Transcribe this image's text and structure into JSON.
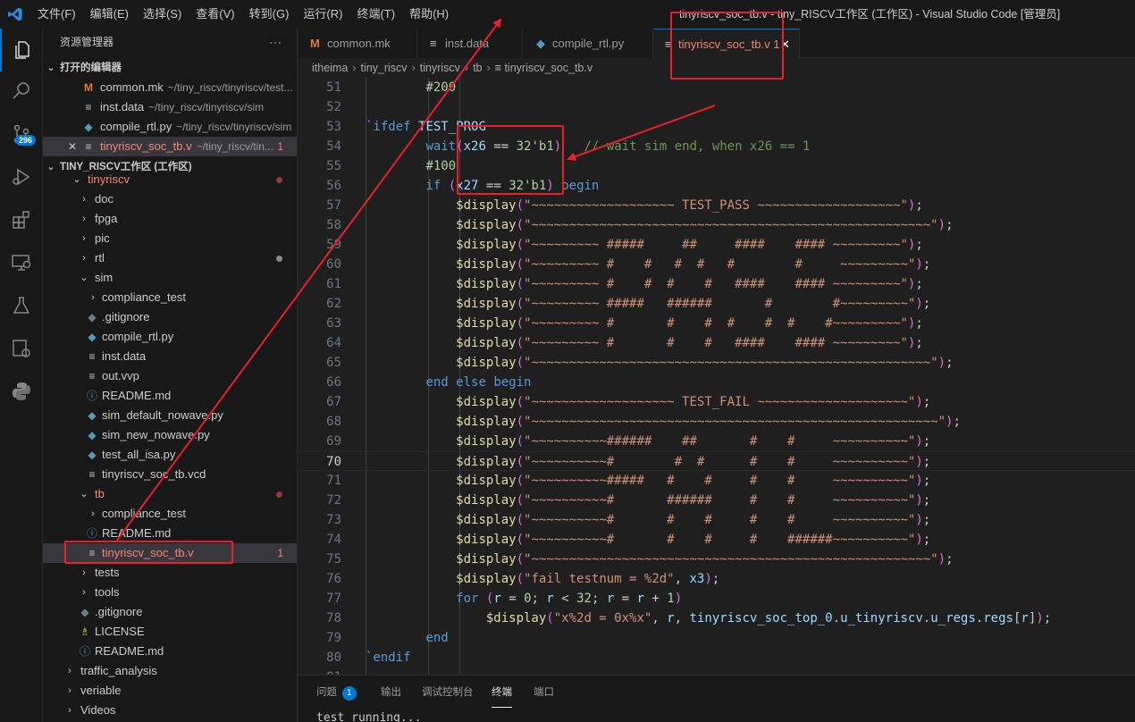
{
  "menu": [
    "文件(F)",
    "编辑(E)",
    "选择(S)",
    "查看(V)",
    "转到(G)",
    "运行(R)",
    "终端(T)",
    "帮助(H)"
  ],
  "window_title": "tinyriscv_soc_tb.v - tiny_RISCV工作区 (工作区) - Visual Studio Code [管理员]",
  "activity": {
    "scm_badge": "296"
  },
  "sidebar": {
    "title": "资源管理器",
    "more": "···",
    "open_editors_header": "打开的编辑器",
    "open_editors": [
      {
        "name": "common.mk",
        "desc": "~/tiny_riscv/tinyriscv/test..."
      },
      {
        "name": "inst.data",
        "desc": "~/tiny_riscv/tinyriscv/sim"
      },
      {
        "name": "compile_rtl.py",
        "desc": "~/tiny_riscv/tinyriscv/sim"
      },
      {
        "name": "tinyriscv_soc_tb.v",
        "desc": "~/tiny_riscv/tin...",
        "problems": "1"
      }
    ],
    "workspace_header": "TINY_RISCV工作区 (工作区)",
    "tree": [
      {
        "name": "tinyriscv"
      },
      {
        "name": "doc"
      },
      {
        "name": "fpga"
      },
      {
        "name": "pic"
      },
      {
        "name": "rtl"
      },
      {
        "name": "sim"
      },
      {
        "name": "compliance_test"
      },
      {
        "name": ".gitignore"
      },
      {
        "name": "compile_rtl.py"
      },
      {
        "name": "inst.data"
      },
      {
        "name": "out.vvp"
      },
      {
        "name": "README.md"
      },
      {
        "name": "sim_default_nowave.py"
      },
      {
        "name": "sim_new_nowave.py"
      },
      {
        "name": "test_all_isa.py"
      },
      {
        "name": "tinyriscv_soc_tb.vcd"
      },
      {
        "name": "tb"
      },
      {
        "name": "compliance_test"
      },
      {
        "name": "README.md"
      },
      {
        "name": "tinyriscv_soc_tb.v",
        "problems": "1"
      },
      {
        "name": "tests"
      },
      {
        "name": "tools"
      },
      {
        "name": ".gitignore"
      },
      {
        "name": "LICENSE"
      },
      {
        "name": "README.md"
      },
      {
        "name": "traffic_analysis"
      },
      {
        "name": "veriable"
      },
      {
        "name": "Videos"
      }
    ]
  },
  "tabs": [
    {
      "label": "common.mk"
    },
    {
      "label": "inst.data"
    },
    {
      "label": "compile_rtl.py"
    },
    {
      "label": "tinyriscv_soc_tb.v 1",
      "close": "✕"
    }
  ],
  "breadcrumb": [
    "itheima",
    "tiny_riscv",
    "tinyriscv",
    "tb",
    "tinyriscv_soc_tb.v"
  ],
  "editor": {
    "current_line": "70",
    "lines": [
      {
        "n": "51",
        "t": "        #200"
      },
      {
        "n": "52",
        "t": ""
      },
      {
        "n": "53",
        "t": "`ifdef TEST_PROG"
      },
      {
        "n": "54",
        "t": "        wait(x26 == 32'b1)   // wait sim end, when x26 == 1"
      },
      {
        "n": "55",
        "t": "        #100"
      },
      {
        "n": "56",
        "t": "        if (x27 == 32'b1) begin"
      },
      {
        "n": "57",
        "t": "            $display(\"~~~~~~~~~~~~~~~~~~~ TEST_PASS ~~~~~~~~~~~~~~~~~~~\");"
      },
      {
        "n": "58",
        "t": "            $display(\"~~~~~~~~~~~~~~~~~~~~~~~~~~~~~~~~~~~~~~~~~~~~~~~~~~~~~\");"
      },
      {
        "n": "59",
        "t": "            $display(\"~~~~~~~~~ #####     ##     ####    #### ~~~~~~~~~\");"
      },
      {
        "n": "60",
        "t": "            $display(\"~~~~~~~~~ #    #   #  #   #        #     ~~~~~~~~~\");"
      },
      {
        "n": "61",
        "t": "            $display(\"~~~~~~~~~ #    #  #    #   ####    #### ~~~~~~~~~\");"
      },
      {
        "n": "62",
        "t": "            $display(\"~~~~~~~~~ #####   ######       #        #~~~~~~~~~\");"
      },
      {
        "n": "63",
        "t": "            $display(\"~~~~~~~~~ #       #    #  #    #  #    #~~~~~~~~~\");"
      },
      {
        "n": "64",
        "t": "            $display(\"~~~~~~~~~ #       #    #   ####    #### ~~~~~~~~~\");"
      },
      {
        "n": "65",
        "t": "            $display(\"~~~~~~~~~~~~~~~~~~~~~~~~~~~~~~~~~~~~~~~~~~~~~~~~~~~~~\");"
      },
      {
        "n": "66",
        "t": "        end else begin"
      },
      {
        "n": "67",
        "t": "            $display(\"~~~~~~~~~~~~~~~~~~~ TEST_FAIL ~~~~~~~~~~~~~~~~~~~~\");"
      },
      {
        "n": "68",
        "t": "            $display(\"~~~~~~~~~~~~~~~~~~~~~~~~~~~~~~~~~~~~~~~~~~~~~~~~~~~~~~\");"
      },
      {
        "n": "69",
        "t": "            $display(\"~~~~~~~~~~######    ##       #    #     ~~~~~~~~~~\");"
      },
      {
        "n": "70",
        "t": "            $display(\"~~~~~~~~~~#        #  #      #    #     ~~~~~~~~~~\");"
      },
      {
        "n": "71",
        "t": "            $display(\"~~~~~~~~~~#####   #    #     #    #     ~~~~~~~~~~\");"
      },
      {
        "n": "72",
        "t": "            $display(\"~~~~~~~~~~#       ######     #    #     ~~~~~~~~~~\");"
      },
      {
        "n": "73",
        "t": "            $display(\"~~~~~~~~~~#       #    #     #    #     ~~~~~~~~~~\");"
      },
      {
        "n": "74",
        "t": "            $display(\"~~~~~~~~~~#       #    #     #    ######~~~~~~~~~~\");"
      },
      {
        "n": "75",
        "t": "            $display(\"~~~~~~~~~~~~~~~~~~~~~~~~~~~~~~~~~~~~~~~~~~~~~~~~~~~~~\");"
      },
      {
        "n": "76",
        "t": "            $display(\"fail testnum = %2d\", x3);"
      },
      {
        "n": "77",
        "t": "            for (r = 0; r < 32; r = r + 1)"
      },
      {
        "n": "78",
        "t": "                $display(\"x%2d = 0x%x\", r, tinyriscv_soc_top_0.u_tinyriscv.u_regs.regs[r]);"
      },
      {
        "n": "79",
        "t": "        end"
      },
      {
        "n": "80",
        "t": "`endif"
      },
      {
        "n": "81",
        "t": ""
      }
    ]
  },
  "panel": {
    "tabs": [
      "问题",
      "输出",
      "调试控制台",
      "终端",
      "端口"
    ],
    "problems_count": "1",
    "terminal_text": "test running..."
  },
  "colors": {
    "accent": "#0078d4",
    "annotation": "#e8202a",
    "keyword": "#569cd6",
    "string": "#ce9178",
    "function": "#dcdcaa",
    "comment": "#6a9955",
    "number": "#b5cea8"
  }
}
